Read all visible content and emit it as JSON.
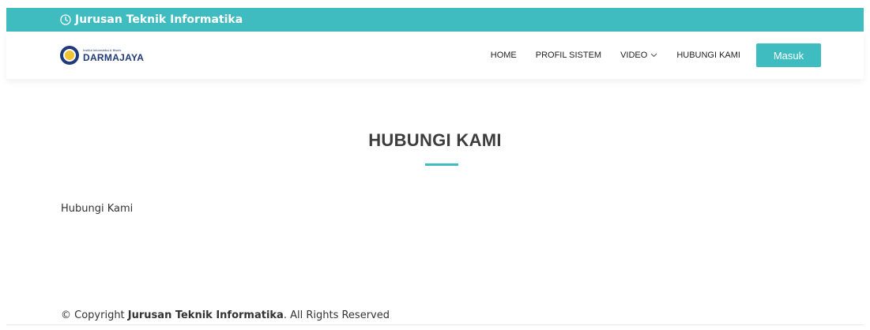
{
  "topbar": {
    "title": "Jurusan Teknik Informatika",
    "icon": "clock-icon",
    "color": "#3fbcc0"
  },
  "header": {
    "logo": {
      "small_text": "Institut Informatika & Bisnis",
      "name": "DARMAJAYA"
    },
    "nav": [
      {
        "label": "HOME"
      },
      {
        "label": "PROFIL SISTEM"
      },
      {
        "label": "VIDEO"
      },
      {
        "label": "HUBUNGI KAMI"
      }
    ],
    "login_label": "Masuk"
  },
  "main": {
    "section_title": "HUBUNGI KAMI",
    "body_text": "Hubungi Kami"
  },
  "footer": {
    "prefix": "© Copyright",
    "org": "Jurusan Teknik Informatika",
    "suffix": ". All Rights Reserved"
  },
  "colors": {
    "accent": "#3fbcc0",
    "brand": "#1f3a7a"
  }
}
